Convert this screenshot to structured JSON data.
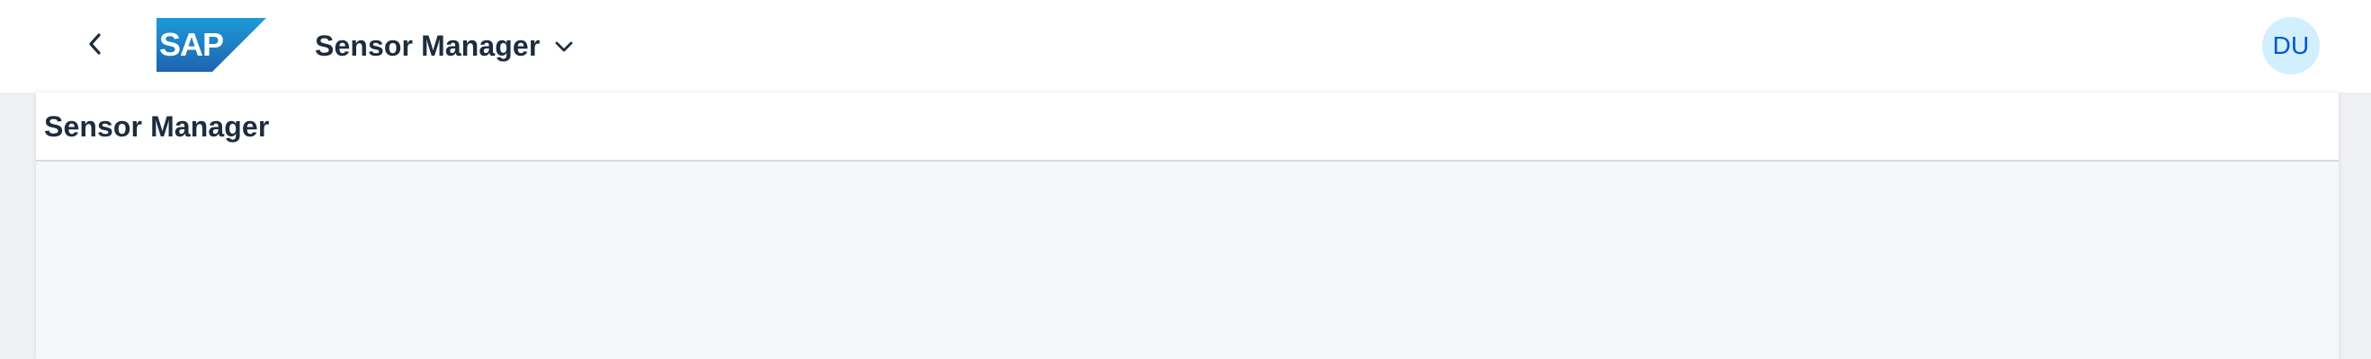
{
  "shellbar": {
    "logo_text": "SAP",
    "app_title": "Sensor Manager",
    "avatar_initials": "DU"
  },
  "page": {
    "title": "Sensor Manager"
  },
  "colors": {
    "shell_background": "#ffffff",
    "title_text": "#1d2d3e",
    "avatar_background": "#d1efff",
    "avatar_text": "#0057d2",
    "logo_blue_light": "#1d9ad9",
    "logo_blue_dark": "#1e64b0",
    "page_background": "#f5f6f7"
  }
}
